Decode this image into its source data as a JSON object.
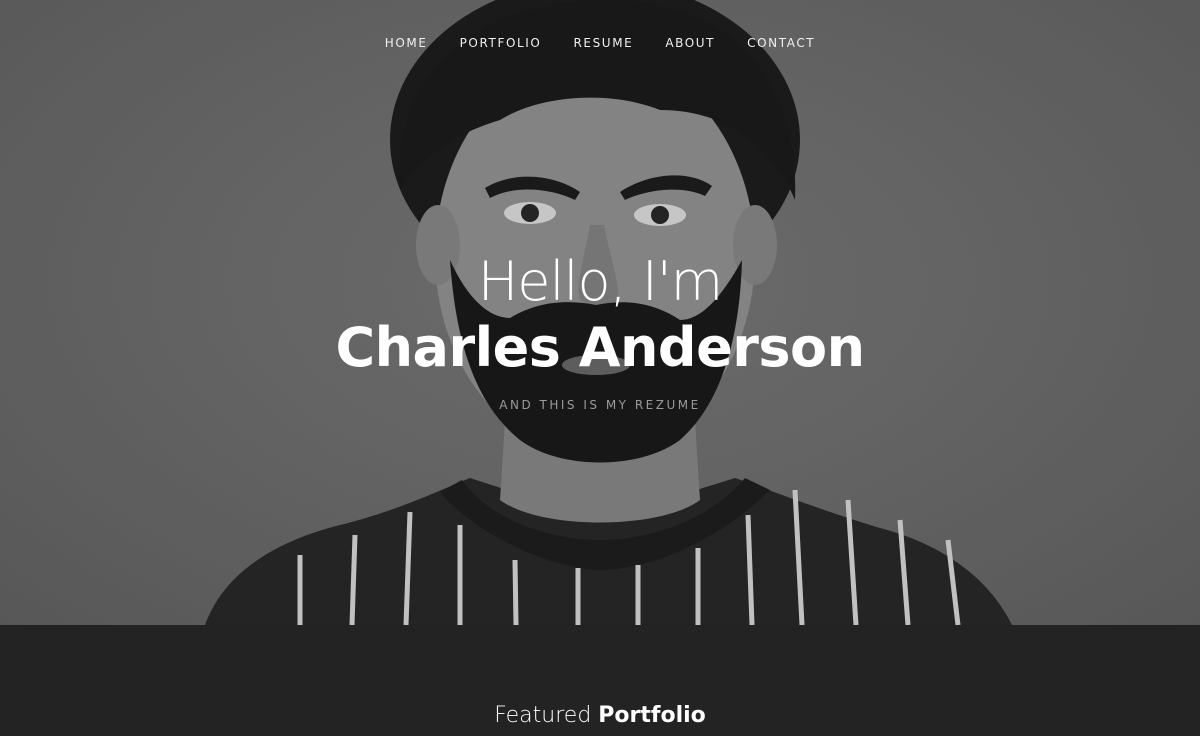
{
  "nav": {
    "items": [
      {
        "label": "HOME"
      },
      {
        "label": "PORTFOLIO"
      },
      {
        "label": "RESUME"
      },
      {
        "label": "ABOUT"
      },
      {
        "label": "CONTACT"
      }
    ]
  },
  "hero": {
    "greeting": "Hello, I'm",
    "name": "Charles Anderson",
    "tagline": "AND THIS IS MY REZUME"
  },
  "featured": {
    "title_light": "Featured",
    "title_bold": "Portfolio"
  },
  "colors": {
    "hero_overlay": "#6f6f6f",
    "section_bg": "#232323",
    "text_primary": "#ffffff",
    "tagline": "#9a9a9a"
  }
}
